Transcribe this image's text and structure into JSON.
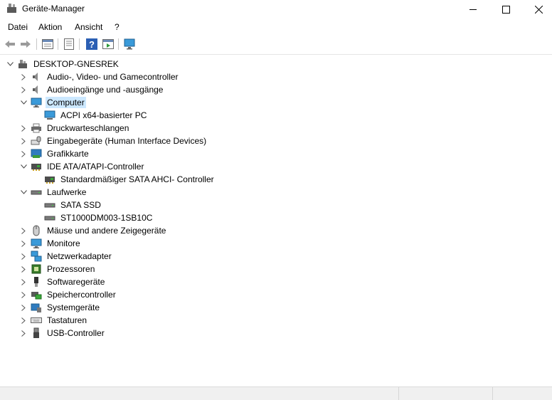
{
  "window": {
    "title": "Geräte-Manager"
  },
  "menu": [
    "Datei",
    "Aktion",
    "Ansicht",
    "?"
  ],
  "toolbar": {
    "buttons": [
      "back-arrow-icon",
      "forward-arrow-icon",
      "properties-icon",
      "view-list-icon",
      "help-icon",
      "run-icon",
      "monitor-scan-icon"
    ]
  },
  "tree": {
    "root": "DESKTOP-GNESREK",
    "categories": [
      {
        "label": "Audio-, Video- und Gamecontroller",
        "icon": "speaker-icon",
        "expanded": false,
        "children": []
      },
      {
        "label": "Audioeingänge und -ausgänge",
        "icon": "speaker-icon",
        "expanded": false,
        "children": []
      },
      {
        "label": "Computer",
        "icon": "monitor-icon",
        "expanded": true,
        "selected": true,
        "children": [
          "ACPI x64-basierter PC"
        ]
      },
      {
        "label": "Druckwarteschlangen",
        "icon": "printer-icon",
        "expanded": false,
        "children": []
      },
      {
        "label": "Eingabegeräte (Human Interface Devices)",
        "icon": "hid-icon",
        "expanded": false,
        "children": []
      },
      {
        "label": "Grafikkarte",
        "icon": "display-adapter-icon",
        "expanded": false,
        "children": []
      },
      {
        "label": "IDE ATA/ATAPI-Controller",
        "icon": "controller-icon",
        "expanded": true,
        "children": [
          "Standardmäßiger SATA AHCI- Controller"
        ]
      },
      {
        "label": "Laufwerke",
        "icon": "disk-drive-icon",
        "expanded": true,
        "children": [
          "SATA SSD",
          "ST1000DM003-1SB10C"
        ]
      },
      {
        "label": "Mäuse und andere Zeigegeräte",
        "icon": "mouse-icon",
        "expanded": false,
        "children": []
      },
      {
        "label": "Monitore",
        "icon": "monitor-icon",
        "expanded": false,
        "children": []
      },
      {
        "label": "Netzwerkadapter",
        "icon": "network-icon",
        "expanded": false,
        "children": []
      },
      {
        "label": "Prozessoren",
        "icon": "processor-icon",
        "expanded": false,
        "children": []
      },
      {
        "label": "Softwaregeräte",
        "icon": "software-device-icon",
        "expanded": false,
        "children": []
      },
      {
        "label": "Speichercontroller",
        "icon": "storage-controller-icon",
        "expanded": false,
        "children": []
      },
      {
        "label": "Systemgeräte",
        "icon": "system-device-icon",
        "expanded": false,
        "children": []
      },
      {
        "label": "Tastaturen",
        "icon": "keyboard-icon",
        "expanded": false,
        "children": []
      },
      {
        "label": "USB-Controller",
        "icon": "usb-icon",
        "expanded": false,
        "children": []
      }
    ]
  },
  "colors": {
    "selection": "#cce8ff",
    "accent": "#0078d7"
  }
}
